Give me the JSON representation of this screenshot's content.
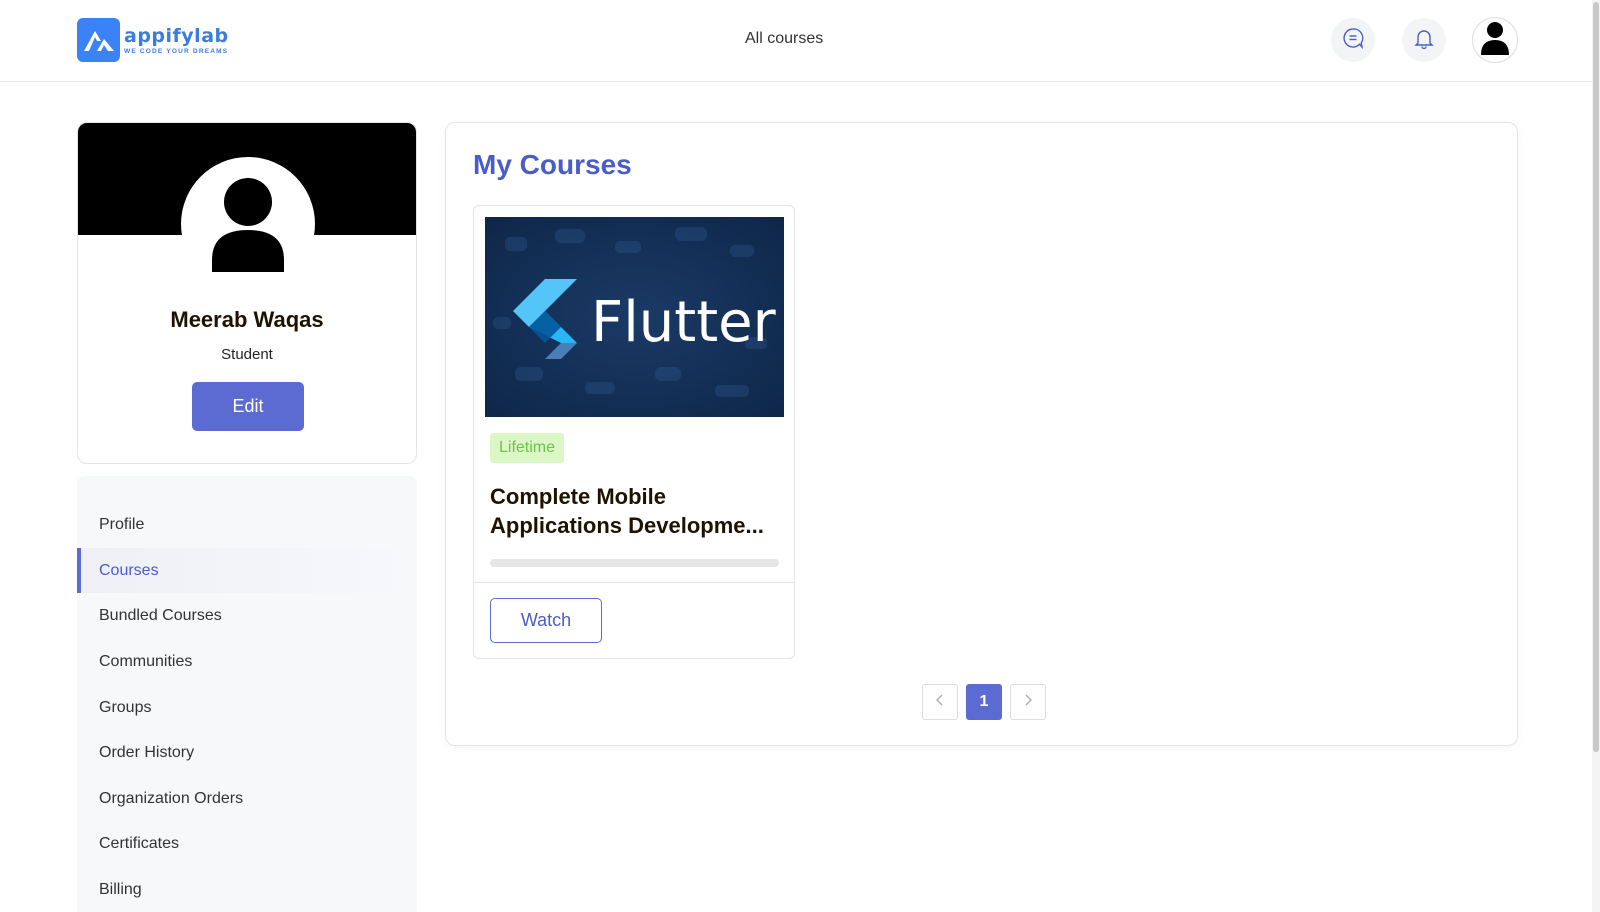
{
  "brand": {
    "name": "appifylab",
    "tagline": "WE CODE YOUR DREAMS",
    "color": "#3b82f6"
  },
  "header": {
    "nav_link": "All courses",
    "icons": [
      "chat-icon",
      "bell-icon",
      "user-avatar-icon"
    ]
  },
  "profile": {
    "name": "Meerab Waqas",
    "role": "Student",
    "edit_label": "Edit"
  },
  "sidebar": {
    "items": [
      {
        "label": "Profile",
        "active": false
      },
      {
        "label": "Courses",
        "active": true
      },
      {
        "label": "Bundled Courses",
        "active": false
      },
      {
        "label": "Communities",
        "active": false
      },
      {
        "label": "Groups",
        "active": false
      },
      {
        "label": "Order History",
        "active": false
      },
      {
        "label": "Organization Orders",
        "active": false
      },
      {
        "label": "Certificates",
        "active": false
      },
      {
        "label": "Billing",
        "active": false
      }
    ]
  },
  "main": {
    "title": "My Courses",
    "courses": [
      {
        "thumbnail_text": "Flutter",
        "badge": "Lifetime",
        "title_line1": "Complete Mobile",
        "title_line2": "Applications Developme...",
        "progress_percent": 0,
        "watch_label": "Watch"
      }
    ],
    "pagination": {
      "prev": "<",
      "pages": [
        "1"
      ],
      "current": "1",
      "next": ">"
    }
  },
  "colors": {
    "accent": "#5b6bd1",
    "accent_text": "#4a5cc9",
    "badge_bg": "#dcf7c6",
    "badge_text": "#6cc24a"
  }
}
